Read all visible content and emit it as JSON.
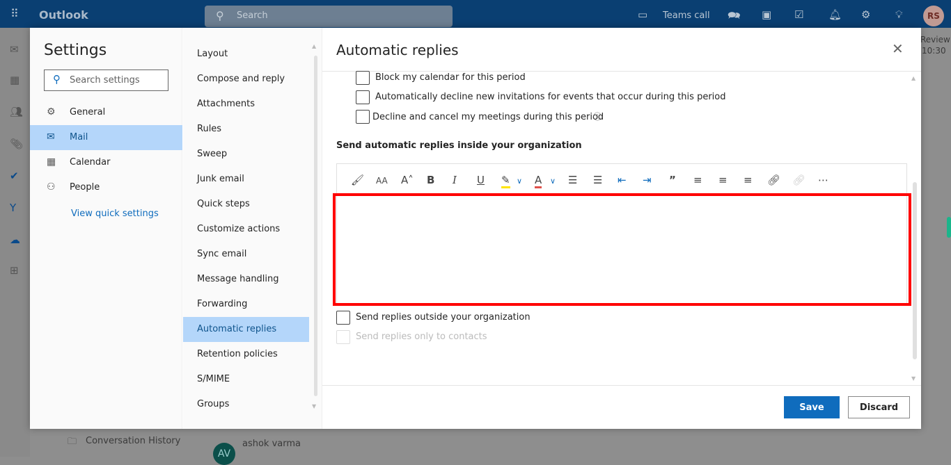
{
  "topbar": {
    "app_name": "Outlook",
    "search_placeholder": "Search",
    "teams_call": "Teams call",
    "avatar_initials": "RS"
  },
  "background": {
    "reminder_title": "Review",
    "reminder_time": "10:30",
    "folder": "Conversation History",
    "sender": "ashok varma",
    "sender_initials": "AV"
  },
  "settings": {
    "title": "Settings",
    "search_placeholder": "Search settings",
    "nav": [
      {
        "label": "General",
        "icon": "gear-icon"
      },
      {
        "label": "Mail",
        "icon": "mail-icon"
      },
      {
        "label": "Calendar",
        "icon": "calendar-icon"
      },
      {
        "label": "People",
        "icon": "people-icon"
      }
    ],
    "selected_nav": "Mail",
    "quick_settings": "View quick settings"
  },
  "mail_settings": {
    "items": [
      "Layout",
      "Compose and reply",
      "Attachments",
      "Rules",
      "Sweep",
      "Junk email",
      "Quick steps",
      "Customize actions",
      "Sync email",
      "Message handling",
      "Forwarding",
      "Automatic replies",
      "Retention policies",
      "S/MIME",
      "Groups"
    ],
    "selected": "Automatic replies"
  },
  "panel": {
    "title": "Automatic replies",
    "options": [
      {
        "label": "Block my calendar for this period",
        "checked": false
      },
      {
        "label": "Automatically decline new invitations for events that occur during this period",
        "checked": false
      },
      {
        "label": "Decline and cancel my meetings during this period",
        "checked": false
      }
    ],
    "inside_heading": "Send automatic replies inside your organization",
    "toolbar": [
      "format-painter-icon",
      "font-size-icon",
      "increase-font-icon",
      "bold-icon",
      "italic-icon",
      "underline-icon",
      "highlight-icon",
      "font-color-icon",
      "bullets-icon",
      "numbering-icon",
      "decrease-indent-icon",
      "increase-indent-icon",
      "quote-icon",
      "align-left-icon",
      "align-center-icon",
      "align-right-icon",
      "link-icon",
      "remove-link-icon",
      "more-icon"
    ],
    "editor_value": "",
    "outside": {
      "label": "Send replies outside your organization",
      "checked": false
    },
    "contacts_only": {
      "label": "Send replies only to contacts",
      "checked": false,
      "disabled": true
    },
    "save": "Save",
    "discard": "Discard",
    "highlight_color": "#ff0000"
  }
}
